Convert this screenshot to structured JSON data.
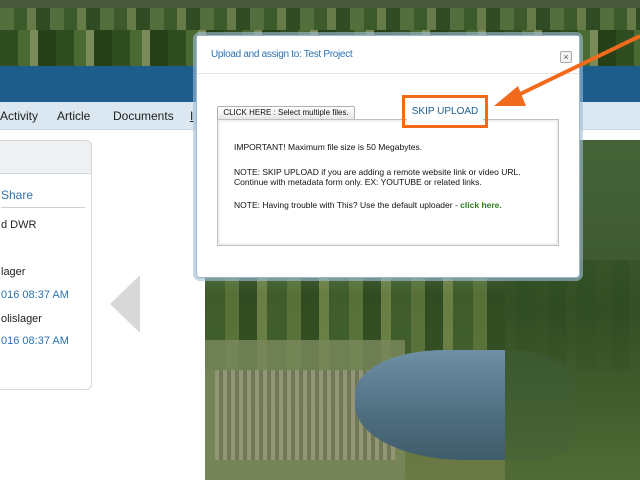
{
  "nav": {
    "items": [
      "Activity",
      "Article",
      "Documents",
      "I"
    ]
  },
  "card": {
    "share_label": "Share",
    "line1": "d DWR",
    "line2": "lager",
    "date1": "016 08:37 AM",
    "line3": "olislager",
    "date2": "016 08:37 AM"
  },
  "dialog": {
    "title": "Upload and assign to: Test Project",
    "close_glyph": "×",
    "select_files_label": "CLICK HERE : Select multiple files.",
    "skip_upload_label": "SKIP UPLOAD",
    "important_note": "IMPORTANT! Maximum file size is 50 Megabytes.",
    "skip_note_line1": "NOTE: SKIP UPLOAD if you are adding a remote website link or video URL.",
    "skip_note_line2": "Continue with metadata form only. EX: YOUTUBE or related links.",
    "trouble_note": "NOTE: Having trouble with This? Use the default uploader -",
    "trouble_link": "click here."
  },
  "colors": {
    "accent_blue": "#1d5d8c",
    "link_blue": "#2b73b2",
    "highlight_orange": "#f26b1d",
    "link_green": "#2e7d1e"
  },
  "icons": {
    "close": "close-icon",
    "prev": "chevron-left-icon",
    "annotation": "arrow-annotation"
  }
}
